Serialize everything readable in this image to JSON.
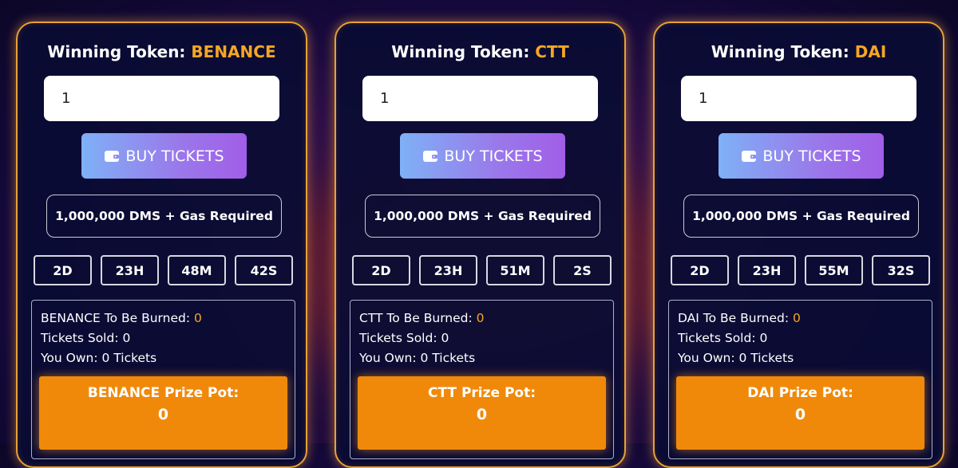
{
  "theme": {
    "accent": "#f6a623",
    "border": "#e9a135",
    "pot_bg": "#f0890a"
  },
  "cards": [
    {
      "title_label": "Winning Token:",
      "token": "BENANCE",
      "quantity": "1",
      "buy_label": "BUY TICKETS",
      "requirement": "1,000,000 DMS + Gas Required",
      "timer": {
        "days": "2D",
        "hours": "23H",
        "minutes": "48M",
        "seconds": "42S"
      },
      "burn_label": "BENANCE To Be Burned:",
      "burn_value": "0",
      "tickets_sold": "Tickets Sold: 0",
      "you_own": "You Own: 0 Tickets",
      "pot_label": "BENANCE Prize Pot:",
      "pot_value": "0"
    },
    {
      "title_label": "Winning Token:",
      "token": "CTT",
      "quantity": "1",
      "buy_label": "BUY TICKETS",
      "requirement": "1,000,000 DMS + Gas Required",
      "timer": {
        "days": "2D",
        "hours": "23H",
        "minutes": "51M",
        "seconds": "2S"
      },
      "burn_label": "CTT To Be Burned:",
      "burn_value": "0",
      "tickets_sold": "Tickets Sold: 0",
      "you_own": "You Own: 0 Tickets",
      "pot_label": "CTT Prize Pot:",
      "pot_value": "0"
    },
    {
      "title_label": "Winning Token:",
      "token": "DAI",
      "quantity": "1",
      "buy_label": "BUY TICKETS",
      "requirement": "1,000,000 DMS + Gas Required",
      "timer": {
        "days": "2D",
        "hours": "23H",
        "minutes": "55M",
        "seconds": "32S"
      },
      "burn_label": "DAI To Be Burned:",
      "burn_value": "0",
      "tickets_sold": "Tickets Sold: 0",
      "you_own": "You Own: 0 Tickets",
      "pot_label": "DAI Prize Pot:",
      "pot_value": "0"
    }
  ]
}
